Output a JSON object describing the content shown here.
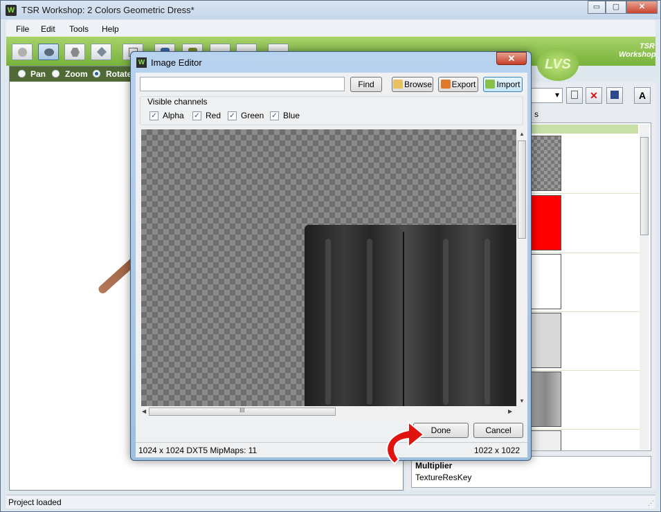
{
  "window": {
    "title": "TSR Workshop: 2 Colors Geometric Dress*",
    "app_icon": "W",
    "min_label": "▭",
    "max_label": "▢",
    "close_label": "✕"
  },
  "menu": [
    "File",
    "Edit",
    "Tools",
    "Help"
  ],
  "view_modes": {
    "pan": "Pan",
    "zoom": "Zoom",
    "rotate": "Rotate",
    "selected": "rotate"
  },
  "logos": {
    "lvs": "LVS",
    "tsr": "TSR Workshop"
  },
  "right_panel": {
    "button_a": "A",
    "label_s": "s",
    "property_name": "Multiplier",
    "property_value": "TextureResKey"
  },
  "status": {
    "text": "Project loaded"
  },
  "dialog": {
    "title": "Image Editor",
    "icon": "W",
    "close": "✕",
    "search_placeholder": "",
    "find": "Find",
    "browse": "Browse",
    "export": "Export",
    "import": "Import",
    "channels_label": "Visible channels",
    "channels": [
      {
        "label": "Alpha",
        "checked": true
      },
      {
        "label": "Red",
        "checked": true
      },
      {
        "label": "Green",
        "checked": true
      },
      {
        "label": "Blue",
        "checked": true
      }
    ],
    "done": "Done",
    "cancel": "Cancel",
    "info": "1024 x 1024 DXT5 MipMaps: 11",
    "size": "1022 x 1022",
    "hscroll_grip": "III"
  },
  "colors": {
    "toolbar_green": "#77b23a",
    "viewbar_green": "#4f6a35",
    "accent_red": "#e0140e",
    "thumb_red": "#ff0000"
  }
}
